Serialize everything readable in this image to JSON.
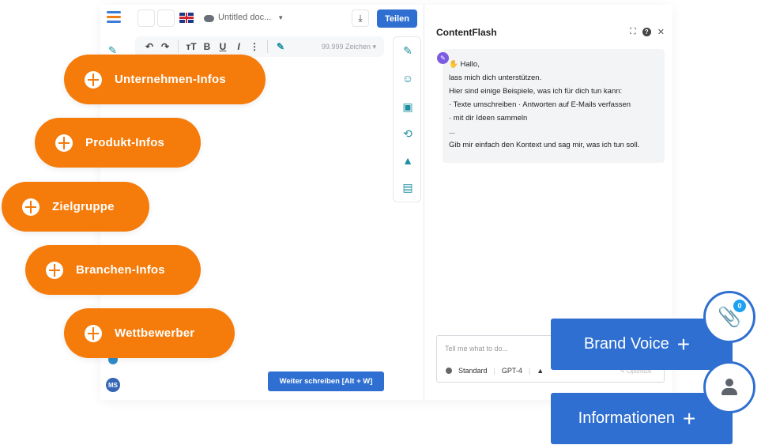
{
  "header": {
    "doc_title": "Untitled doc...",
    "share_label": "Teilen",
    "download_icon": "download-icon",
    "language_flag": "uk-flag-icon"
  },
  "toolbar": {
    "undo": "↶",
    "redo": "↷",
    "textsize": "тT",
    "bold": "B",
    "underline": "U",
    "italic": "I",
    "more": "⋮",
    "char_count": "99.999 Zeichen"
  },
  "editor": {
    "continue_label": "Weiter schreiben  [Alt + W]",
    "user_initials": "MS"
  },
  "panel": {
    "title": "ContentFlash",
    "chat": {
      "greeting": "Hallo,",
      "lines": [
        "lass mich dich unterstützen.",
        "Hier sind einige Beispiele, was ich für dich tun kann:",
        "· Texte umschreiben · Antworten auf E-Mails verfassen",
        "· mit dir Ideen sammeln",
        "...",
        "Gib mir einfach den Kontext und sag mir, was ich tun soll."
      ]
    },
    "input_placeholder": "Tell me what to do...",
    "mode_label": "Standard",
    "model_label": "GPT-4",
    "optimize_label": "Optimize"
  },
  "pills": [
    {
      "label": "Unternehmen-Infos"
    },
    {
      "label": "Produkt-Infos"
    },
    {
      "label": "Zielgruppe"
    },
    {
      "label": "Branchen-Infos"
    },
    {
      "label": "Wettbewerber"
    }
  ],
  "cta": {
    "brand_voice": "Brand Voice",
    "informationen": "Informationen",
    "attachments_count": "0"
  },
  "colors": {
    "accent_blue": "#2f6fd1",
    "accent_orange": "#f57b0a",
    "teal_icons": "#1d8fa0"
  }
}
